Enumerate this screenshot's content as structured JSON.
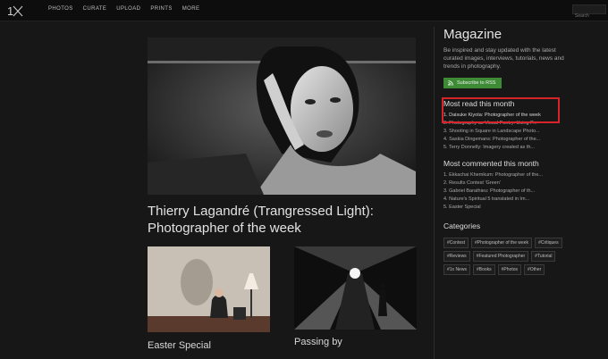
{
  "nav": {
    "items": [
      "PHOTOS",
      "CURATE",
      "UPLOAD",
      "PRINTS",
      "MORE"
    ],
    "search_placeholder": "Search"
  },
  "main": {
    "hero_title": "Thierry Lagandré (Trangressed Light): Photographer of the week",
    "articles": [
      {
        "title": "Easter Special"
      },
      {
        "title": "Passing by"
      }
    ]
  },
  "sidebar": {
    "title": "Magazine",
    "description": "Be inspired and stay updated with the latest curated images, interviews, tutorials, news and trends in photography.",
    "rss_label": "Subscribe to RSS",
    "most_read_title": "Most read this month",
    "most_read": [
      "1. Daisuke Kiyota: Photographer of the week",
      "2. Photography as Visual Poetry: Using P...",
      "3. Shooting in Square in Landscape Photo...",
      "4. Saskia Dingemans: Photographer of the...",
      "5. Terry Donnelly: Imagery created as th..."
    ],
    "most_commented_title": "Most commented this month",
    "most_commented": [
      "1. Ekkachai Khemkum: Photographer of the...",
      "2. Results Contest 'Green'",
      "3. Gabriel Barathieu: Photographer of th...",
      "4. Nature's Spiritual 5 translated in Im...",
      "5. Easter Special"
    ],
    "categories_title": "Categories",
    "categories": [
      "#Contest",
      "#Photographer of the week",
      "#Critiques",
      "#Reviews",
      "#Featured Photographer",
      "#Tutorial",
      "#1x News",
      "#Books",
      "#Photos",
      "#Other"
    ]
  },
  "colors": {
    "background": "#171717",
    "rss_green": "#3d8b35",
    "highlight_red": "#d9232a"
  },
  "icons": [
    "1x-logo",
    "rss-icon"
  ]
}
